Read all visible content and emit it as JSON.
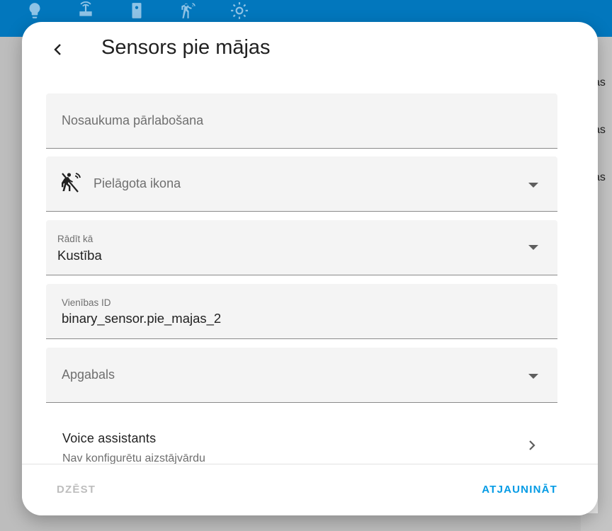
{
  "topbar": {
    "color": "#0277bd",
    "icons": [
      "lightbulb-icon",
      "router-wireless-icon",
      "sensor-icon",
      "motion-sensor-icon",
      "sun-icon"
    ]
  },
  "background": {
    "clipped_texts": [
      "as",
      "as",
      "as"
    ]
  },
  "dialog": {
    "title": "Sensors pie mājas",
    "back_icon": "chevron-left-icon"
  },
  "fields": {
    "name_override": {
      "placeholder": "Nosaukuma pārlabošana",
      "value": ""
    },
    "custom_icon": {
      "placeholder": "Pielāgota ikona",
      "icon": "motion-sensor-icon"
    },
    "show_as": {
      "label": "Rādīt kā",
      "value": "Kustība"
    },
    "entity_id": {
      "label": "Vienības ID",
      "value": "binary_sensor.pie_majas_2"
    },
    "area": {
      "placeholder": "Apgabals"
    }
  },
  "voice_assistants": {
    "title": "Voice assistants",
    "subtitle": "Nav konfigurētu aizstājvārdu"
  },
  "footer": {
    "delete_label": "DZĒST",
    "update_label": "ATJAUNINĀT",
    "accent_color": "#039be5"
  }
}
